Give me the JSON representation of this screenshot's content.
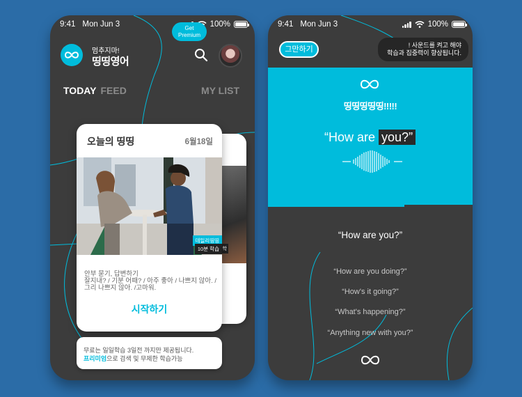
{
  "status": {
    "time": "9:41",
    "date": "Mon Jun 3",
    "battery": "100%"
  },
  "home": {
    "brand_sub": "멈추지마!",
    "brand_title": "띵띵영어",
    "tabs": [
      {
        "label": "TODAY",
        "active": true
      },
      {
        "label": "FEED",
        "active": false
      },
      {
        "label": "MY LIST",
        "active": false
      }
    ],
    "card": {
      "title": "오늘의 띵띵",
      "date": "6월18일",
      "badge_top": "데일리띵띵",
      "badge_bottom": "10분 학습",
      "desc_lines": [
        "안부 묻기, 답변하기",
        "잘지내? / 기분 어때? / 아주 좋아 / 나쁘지 않아. /",
        "그리 나쁘지 않아. /고마워."
      ],
      "start_label": "시작하기"
    },
    "back_cards": {
      "date_fragment": "일",
      "label_fragment": "학",
      "text_fragment": "잘"
    },
    "promo": {
      "line1": "무료는 일일학습 3일전 까지만 제공됩니다.",
      "line2_highlight": "프리미엄",
      "line2_rest": "으로 검색 및 무제한 학습가능",
      "button_line1": "Get",
      "button_line2": "Premium"
    }
  },
  "lesson": {
    "stop_label": "그만하기",
    "toast_line1": "! 사운드를 켜고 해야",
    "toast_line2": "학습과 집중력이 향상됩니다.",
    "panel_title": "띵띵띵띵띵!!!!!",
    "quote_plain": "“How are",
    "quote_highlight": "you?”",
    "main_phrase": "“How are you?”",
    "alternatives": [
      "“How are you doing?”",
      "“How's it going?”",
      "“What's happening?”",
      "“Anything new with you?”"
    ]
  },
  "colors": {
    "accent": "#00bcdc",
    "background": "#2b6ca7",
    "phone": "#3c3c3c"
  },
  "icons": [
    "infinity-icon",
    "search-icon",
    "wifi-icon",
    "signal-icon",
    "battery-icon",
    "soundwave-icon"
  ]
}
